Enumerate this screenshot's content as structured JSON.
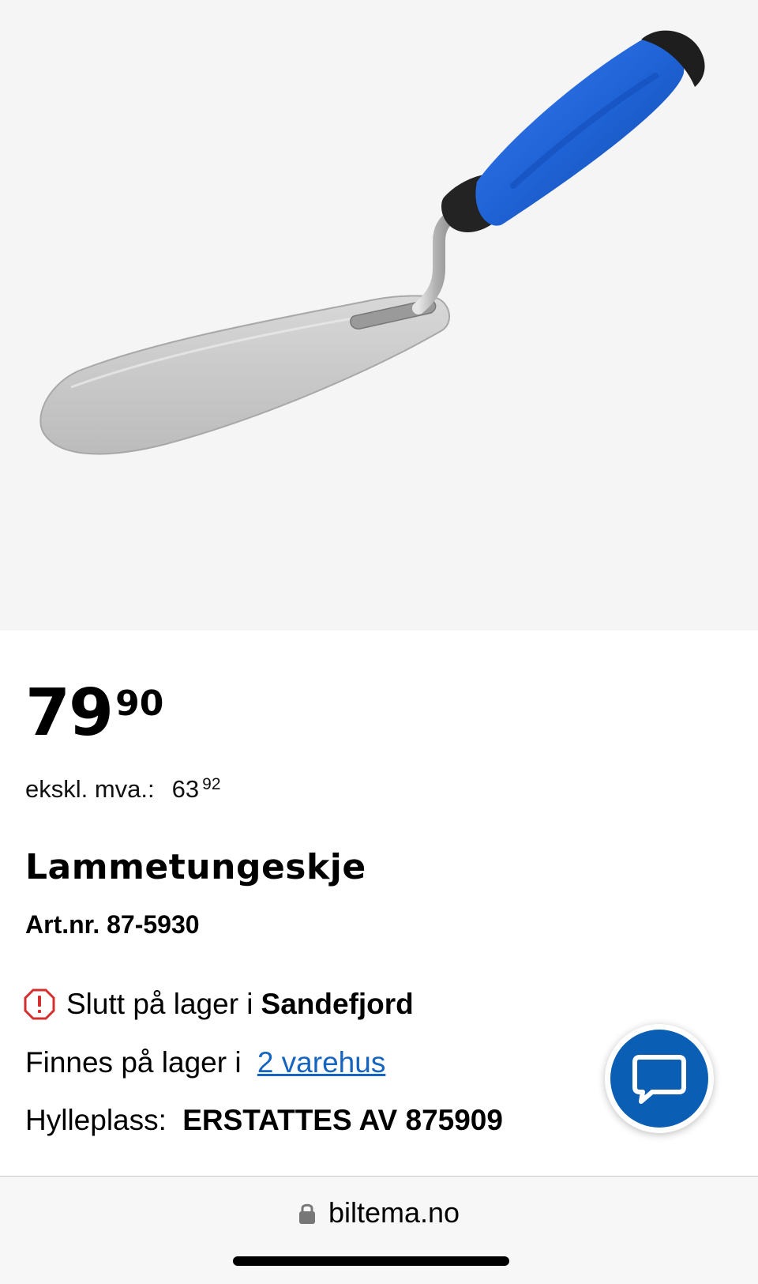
{
  "product": {
    "image_alt": "Lammetungeskje",
    "price_main": "79",
    "price_cents": "90",
    "vat_label": "ekskl. mva.:",
    "vat_main": "63",
    "vat_cents": "92",
    "title": "Lammetungeskje",
    "art_nr": "Art.nr. 87-5930"
  },
  "stock": {
    "out_of_stock_text": "Slutt på lager i",
    "store_name": "Sandefjord",
    "available_text": "Finnes på lager i",
    "available_link": "2 varehus",
    "shelf_label": "Hylleplass:",
    "shelf_value": "ERSTATTES AV 875909"
  },
  "chat": {
    "icon": "chat-bubble-icon",
    "color": "#0a5fb4"
  },
  "browser": {
    "url": "biltema.no",
    "lock_icon": "lock-icon"
  },
  "colors": {
    "link": "#1565c0",
    "alert": "#d32f2f",
    "handle_blue": "#1f63d6"
  }
}
